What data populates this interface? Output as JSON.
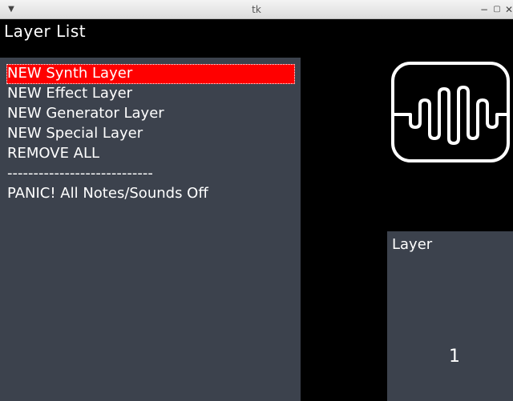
{
  "window": {
    "title": "tk"
  },
  "app": {
    "title": "Layer List"
  },
  "layer_list": {
    "items": [
      {
        "label": "NEW Synth Layer",
        "selected": true
      },
      {
        "label": "NEW Effect Layer",
        "selected": false
      },
      {
        "label": "NEW Generator Layer",
        "selected": false
      },
      {
        "label": "NEW Special Layer",
        "selected": false
      },
      {
        "label": "REMOVE ALL",
        "selected": false
      },
      {
        "label": "----------------------------",
        "selected": false
      },
      {
        "label": "PANIC! All Notes/Sounds Off",
        "selected": false
      }
    ]
  },
  "logo": {
    "icon": "waveform-icon"
  },
  "layer_panel": {
    "label": "Layer",
    "value": "1"
  },
  "colors": {
    "background": "#000000",
    "panel": "#3c424d",
    "selection": "#ff0000",
    "text": "#ffffff"
  }
}
